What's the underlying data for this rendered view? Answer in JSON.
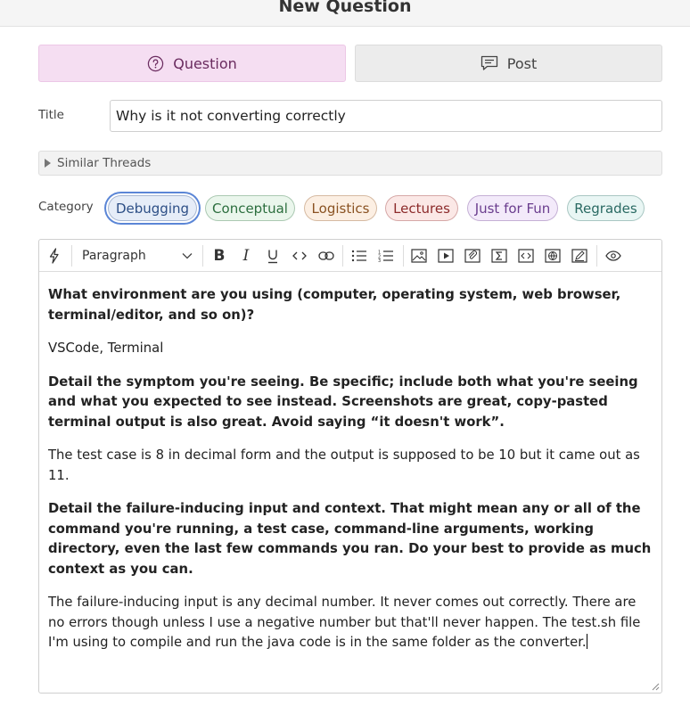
{
  "header": {
    "title": "New Question"
  },
  "post_type": {
    "question_label": "Question",
    "post_label": "Post",
    "selected": "question"
  },
  "title_field": {
    "label": "Title",
    "value": "Why is it not converting correctly"
  },
  "similar_threads": {
    "label": "Similar Threads"
  },
  "category": {
    "label": "Category",
    "items": [
      {
        "label": "Debugging",
        "color": "#2d4f86",
        "bg": "#e6edf8",
        "selected": true
      },
      {
        "label": "Conceptual",
        "color": "#2c6e3e",
        "bg": "#eaf6ec"
      },
      {
        "label": "Logistics",
        "color": "#8a5222",
        "bg": "#fcefe3"
      },
      {
        "label": "Lectures",
        "color": "#8c2b2b",
        "bg": "#fbe8e6"
      },
      {
        "label": "Just for Fun",
        "color": "#6a3d8e",
        "bg": "#f3eafa"
      },
      {
        "label": "Regrades",
        "color": "#2a6a63",
        "bg": "#e9f6f4"
      }
    ]
  },
  "editor": {
    "toolbar": {
      "paragraph_select": "Paragraph",
      "icons": [
        "ai-icon",
        "bold-icon",
        "italic-icon",
        "underline-icon",
        "code-icon",
        "link-icon",
        "bullet-list-icon",
        "numbered-list-icon",
        "image-icon",
        "video-icon",
        "attachment-icon",
        "math-icon",
        "code-block-icon",
        "web-embed-icon",
        "draw-icon",
        "preview-icon"
      ]
    },
    "content": [
      {
        "bold": true,
        "text": "What environment are you using (computer, operating system, web browser, terminal/editor, and so on)?"
      },
      {
        "bold": false,
        "text": "VSCode, Terminal"
      },
      {
        "bold": true,
        "text": "Detail the symptom you're seeing. Be specific; include both what you're seeing and what you expected to see instead. Screenshots are great, copy-pasted terminal output is also great. Avoid saying “it doesn't work”."
      },
      {
        "bold": false,
        "text": "The test case is 8 in decimal form and the output is supposed to be 10 but it came out as 11."
      },
      {
        "bold": true,
        "text": "Detail the failure-inducing input and context. That might mean any or all of the command you're running, a test case, command-line arguments, working directory, even the last few commands you ran. Do your best to provide as much context as you can."
      },
      {
        "bold": false,
        "text": "The failure-inducing input is any decimal number. It never comes out correctly. There are no errors though unless I use a negative number but that'll never happen. The test.sh file I'm using to compile and run the java code is in the same folder as the converter."
      }
    ]
  }
}
